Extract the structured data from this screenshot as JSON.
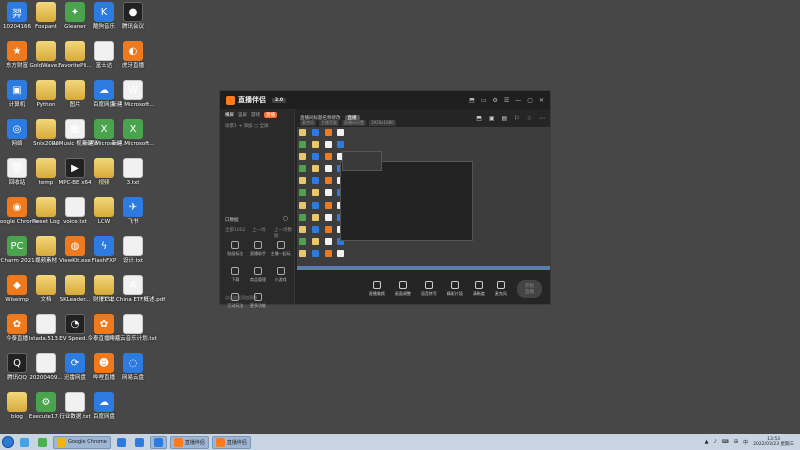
{
  "desktop": {
    "icons": [
      {
        "label": "10204166",
        "style": "blue",
        "glyph": "羿"
      },
      {
        "label": "Foxpant",
        "style": "folder",
        "glyph": ""
      },
      {
        "label": "Gleaner",
        "style": "green",
        "glyph": "✦"
      },
      {
        "label": "酷狗音乐",
        "style": "blue round",
        "glyph": "K"
      },
      {
        "label": "腾讯会议",
        "style": "dark round",
        "glyph": "●"
      },
      {
        "label": "东方财富",
        "style": "orange round",
        "glyph": "★"
      },
      {
        "label": "GoldWave...",
        "style": "folder",
        "glyph": ""
      },
      {
        "label": "FavoritePli...",
        "style": "folder",
        "glyph": ""
      },
      {
        "label": "富士达",
        "style": "doc",
        "glyph": ""
      },
      {
        "label": "虎牙直播",
        "style": "orange round",
        "glyph": "◐"
      },
      {
        "label": "计算机",
        "style": "blue",
        "glyph": "▣"
      },
      {
        "label": "Python",
        "style": "folder",
        "glyph": ""
      },
      {
        "label": "图片",
        "style": "folder",
        "glyph": ""
      },
      {
        "label": "百度网盘",
        "style": "blue",
        "glyph": "☁"
      },
      {
        "label": "新建 Microsoft...",
        "style": "doc",
        "glyph": "W"
      },
      {
        "label": "网络",
        "style": "blue",
        "glyph": "◎"
      },
      {
        "label": "Snix2020",
        "style": "folder",
        "glyph": ""
      },
      {
        "label": "ReMusic 视频编辑",
        "style": "doc",
        "glyph": "▦"
      },
      {
        "label": "新建 Microsoft...",
        "style": "green",
        "glyph": "X"
      },
      {
        "label": "新建 Microsoft...",
        "style": "green",
        "glyph": "X"
      },
      {
        "label": "回收站",
        "style": "doc",
        "glyph": "🗑"
      },
      {
        "label": "temp",
        "style": "folder",
        "glyph": ""
      },
      {
        "label": "MPC-BE x64",
        "style": "dark",
        "glyph": "▶"
      },
      {
        "label": "视频",
        "style": "folder",
        "glyph": ""
      },
      {
        "label": "3.txt",
        "style": "doc",
        "glyph": ""
      },
      {
        "label": "Google Chrome",
        "style": "orange round",
        "glyph": "◉"
      },
      {
        "label": "Tweet Log",
        "style": "folder",
        "glyph": ""
      },
      {
        "label": "voice.txt",
        "style": "doc",
        "glyph": ""
      },
      {
        "label": "LCW",
        "style": "folder",
        "glyph": ""
      },
      {
        "label": "飞书",
        "style": "blue",
        "glyph": "✈"
      },
      {
        "label": "PyCharm 2021.3",
        "style": "green",
        "glyph": "PC"
      },
      {
        "label": "视频素材",
        "style": "folder",
        "glyph": ""
      },
      {
        "label": "ViewKit.exe",
        "style": "orange round",
        "glyph": "◍"
      },
      {
        "label": "FlashFXP",
        "style": "blue",
        "glyph": "ϟ"
      },
      {
        "label": "设计.txt",
        "style": "doc",
        "glyph": ""
      },
      {
        "label": "Wiseimp",
        "style": "orange",
        "glyph": "◆"
      },
      {
        "label": "文档",
        "style": "folder",
        "glyph": ""
      },
      {
        "label": "SKLeader...",
        "style": "folder",
        "glyph": ""
      },
      {
        "label": "财报汇总",
        "style": "folder",
        "glyph": ""
      },
      {
        "label": "FTSE China ETF概述.pdf",
        "style": "doc",
        "glyph": "A"
      },
      {
        "label": "今泰直播",
        "style": "orange",
        "glyph": "✿"
      },
      {
        "label": "Istada.513...",
        "style": "doc",
        "glyph": ""
      },
      {
        "label": "EV Speed...",
        "style": "dark round",
        "glyph": "◔"
      },
      {
        "label": "今泰直播中控",
        "style": "orange",
        "glyph": "✿"
      },
      {
        "label": "网易云音乐计划.txt",
        "style": "doc",
        "glyph": ""
      },
      {
        "label": "腾讯QQ",
        "style": "dark round",
        "glyph": "Q"
      },
      {
        "label": "20200409...",
        "style": "doc",
        "glyph": ""
      },
      {
        "label": "迅雷网盘",
        "style": "blue",
        "glyph": "⟳"
      },
      {
        "label": "哔哩直播",
        "style": "orange",
        "glyph": "☻"
      },
      {
        "label": "网易云盘",
        "style": "blue round",
        "glyph": "◌"
      },
      {
        "label": "blog",
        "style": "folder",
        "glyph": ""
      },
      {
        "label": "Execute17...",
        "style": "green",
        "glyph": "⚙"
      },
      {
        "label": "行业数据.txt",
        "style": "doc",
        "glyph": ""
      },
      {
        "label": "百度网盘",
        "style": "blue",
        "glyph": "☁"
      },
      {
        "label": "",
        "style": "",
        "glyph": ""
      }
    ]
  },
  "window": {
    "title": "直播伴侣",
    "version": "2.0",
    "controls": [
      "⬒",
      "▭",
      "⚙",
      "☰",
      "—",
      "▢",
      "✕"
    ],
    "sidebar": {
      "tabs": [
        "横屏",
        "竖屏",
        "游戏",
        "直播"
      ],
      "scene_label": "场景1",
      "scene_items": [
        "+ 添加",
        "▢ 全屏"
      ],
      "source_label": "口数据",
      "row_labels": [
        "全部1002",
        "上一场",
        "上一场数据"
      ],
      "tools": [
        "贴画标注",
        "直播助手",
        "主播一起玩",
        "下载",
        "商品管理",
        "小游戏",
        "互动玩法",
        "更多功能",
        ""
      ],
      "footer": "点击这里添加直播"
    },
    "main": {
      "room_title": "直播间标题名称修改",
      "live_badge": "直播",
      "sub_tabs": [
        "麦克风",
        "主播音量",
        "直播间设置",
        "1920x1080"
      ],
      "right_icons": [
        "⬒",
        "▣",
        "▤",
        "⚐",
        "♢",
        "⋯"
      ],
      "bottom_tools": [
        "直播美颜",
        "画面调整",
        "语音转写",
        "精彩片段",
        "清晰度",
        "麦克风"
      ],
      "start_button": "开始直播"
    }
  },
  "taskbar": {
    "items": [
      {
        "label": "",
        "color": "#44a3e0",
        "open": false
      },
      {
        "label": "",
        "color": "#4caf50",
        "open": false
      },
      {
        "label": "Google Chrome",
        "color": "#f4b400",
        "open": true
      },
      {
        "label": "",
        "color": "#2d7be0",
        "open": false
      },
      {
        "label": "",
        "color": "#2d7be0",
        "open": false
      },
      {
        "label": "",
        "color": "#2d7be0",
        "open": true
      },
      {
        "label": "直播伴侣",
        "color": "#ff7a1a",
        "open": true
      },
      {
        "label": "直播伴侣",
        "color": "#ff7a1a",
        "open": true
      }
    ],
    "tray": [
      "▲",
      "♪",
      "⌨",
      "⊞",
      "中"
    ],
    "time": "13:53",
    "date": "2022/03/23 星期三"
  }
}
